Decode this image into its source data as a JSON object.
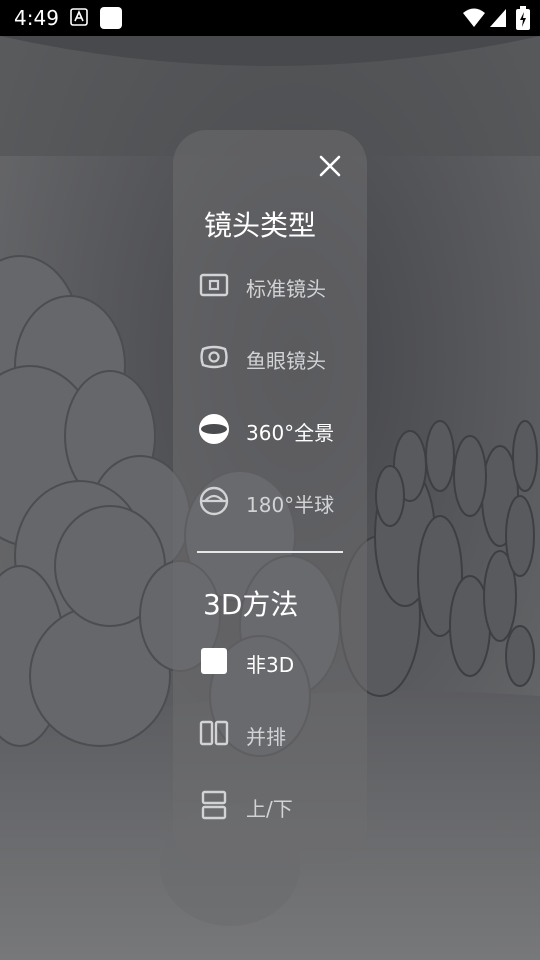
{
  "status_bar": {
    "time": "4:49"
  },
  "menu": {
    "lens_section": {
      "title": "镜头类型",
      "items": [
        {
          "label": "标准镜头",
          "icon": "standard-lens-icon",
          "selected": false
        },
        {
          "label": "鱼眼镜头",
          "icon": "fisheye-lens-icon",
          "selected": false
        },
        {
          "label": "360°全景",
          "icon": "panorama-360-icon",
          "selected": true
        },
        {
          "label": "180°半球",
          "icon": "hemisphere-180-icon",
          "selected": false
        }
      ]
    },
    "method_section": {
      "title": "3D方法",
      "items": [
        {
          "label": "非3D",
          "icon": "non-3d-icon",
          "selected": true
        },
        {
          "label": "并排",
          "icon": "side-by-side-icon",
          "selected": false
        },
        {
          "label": "上/下",
          "icon": "top-bottom-icon",
          "selected": false
        }
      ]
    }
  }
}
